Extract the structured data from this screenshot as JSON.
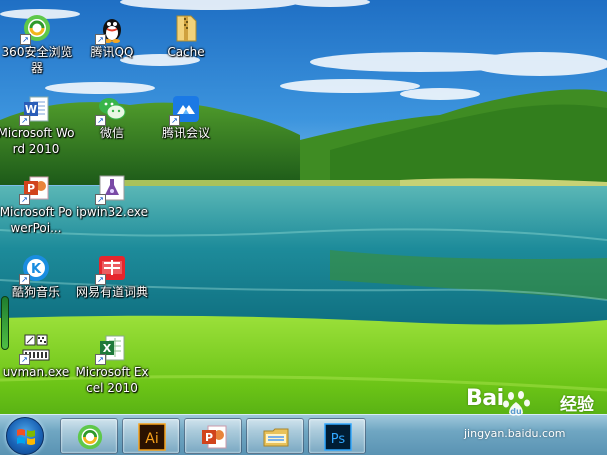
{
  "desktop": {
    "icons": [
      {
        "label": "360安全浏览器",
        "icon": "360-browser-icon"
      },
      {
        "label": "腾讯QQ",
        "icon": "qq-penguin-icon"
      },
      {
        "label": "Cache",
        "icon": "folder-zipper-icon"
      },
      {
        "label": "Microsoft Word 2010",
        "icon": "word-icon"
      },
      {
        "label": "微信",
        "icon": "wechat-icon"
      },
      {
        "label": "腾讯会议",
        "icon": "tencent-meeting-icon"
      },
      {
        "label": "Microsoft PowerPoi...",
        "icon": "powerpoint-icon"
      },
      {
        "label": "ipwin32.exe",
        "icon": "ipwin32-icon"
      },
      {
        "label": "酷狗音乐",
        "icon": "kugou-icon"
      },
      {
        "label": "网易有道词典",
        "icon": "youdao-dict-icon"
      },
      {
        "label": "uvman.exe",
        "icon": "uvman-icon"
      },
      {
        "label": "Microsoft Excel 2010",
        "icon": "excel-icon"
      }
    ]
  },
  "taskbar": {
    "start_icon": "windows-start-icon",
    "pinned": [
      {
        "name": "360 Browser",
        "icon": "360-browser-icon"
      },
      {
        "name": "Illustrator",
        "icon": "illustrator-icon",
        "text": "Ai"
      },
      {
        "name": "PowerPoint",
        "icon": "powerpoint-icon",
        "text": "P"
      },
      {
        "name": "Windows Explorer",
        "icon": "folder-icon"
      },
      {
        "name": "Photoshop",
        "icon": "photoshop-icon",
        "text": "Ps"
      }
    ]
  },
  "watermark": {
    "brand": "Bai",
    "brand_tail": "经验",
    "url": "jingyan.baidu.com"
  },
  "colors": {
    "sky": "#2c86d6",
    "water": "#2a9aa6",
    "grass": "#7fcf1f",
    "taskbar": "#6fa6c2"
  }
}
